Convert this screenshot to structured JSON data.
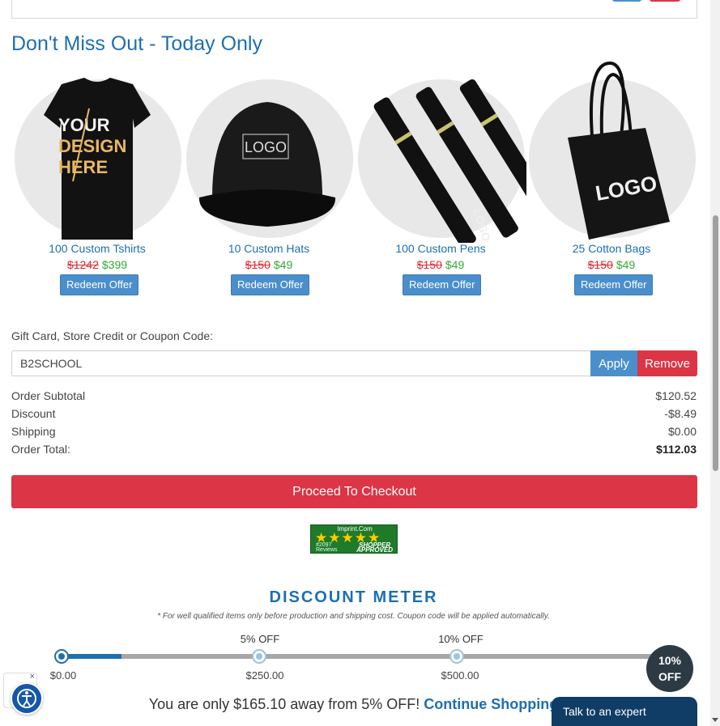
{
  "section_title": "Don't Miss Out - Today Only",
  "offers": [
    {
      "name": "100 Custom Tshirts",
      "old_price": "$1242",
      "new_price": "$399",
      "redeem": "Redeem Offer",
      "art_text": [
        "YOUR",
        "DESIGN",
        "HERE"
      ]
    },
    {
      "name": "10 Custom Hats",
      "old_price": "$150",
      "new_price": "$49",
      "redeem": "Redeem Offer",
      "art_text": [
        "LOGO"
      ]
    },
    {
      "name": "100 Custom Pens",
      "old_price": "$150",
      "new_price": "$49",
      "redeem": "Redeem Offer",
      "art_text": [
        "LOGO"
      ]
    },
    {
      "name": "25 Cotton Bags",
      "old_price": "$150",
      "new_price": "$49",
      "redeem": "Redeem Offer",
      "art_text": [
        "LOGO"
      ]
    }
  ],
  "coupon": {
    "label": "Gift Card, Store Credit or Coupon Code:",
    "value": "B2SCHOOL",
    "apply": "Apply",
    "remove": "Remove"
  },
  "totals": [
    {
      "label": "Order Subtotal",
      "value": "$120.52"
    },
    {
      "label": "Discount",
      "value": "-$8.49"
    },
    {
      "label": "Shipping",
      "value": "$0.00"
    },
    {
      "label": "Order Total:",
      "value": "$112.03"
    }
  ],
  "checkout_label": "Proceed To Checkout",
  "shopper_badge": {
    "site": "Imprint.Com",
    "reviews_count": "#2097",
    "reviews_label": "Reviews",
    "approved_top": "SHOPPER",
    "approved_bottom": "APPROVED",
    "stars": 5
  },
  "meter": {
    "title": "DISCOUNT METER",
    "note": "* For well qualified items only before production and shipping cost. Coupon code will be applied automatically.",
    "progress": 0.099,
    "tiers": [
      {
        "top": "",
        "bottom": "$0.00"
      },
      {
        "top": "5% OFF",
        "bottom": "$250.00"
      },
      {
        "top": "10% OFF",
        "bottom": "$500.00"
      }
    ],
    "final_line1": "10%",
    "final_line2": "OFF"
  },
  "away_message": "You are only $165.10 away from 5% OFF!",
  "continue_link": "Continue Shopping",
  "expert_label": "Talk to an expert",
  "colors": {
    "primary": "#1d6fb0",
    "danger": "#dc3545",
    "apply": "#4a8fcc",
    "sale": "#35a832",
    "strike": "#d9272e"
  }
}
